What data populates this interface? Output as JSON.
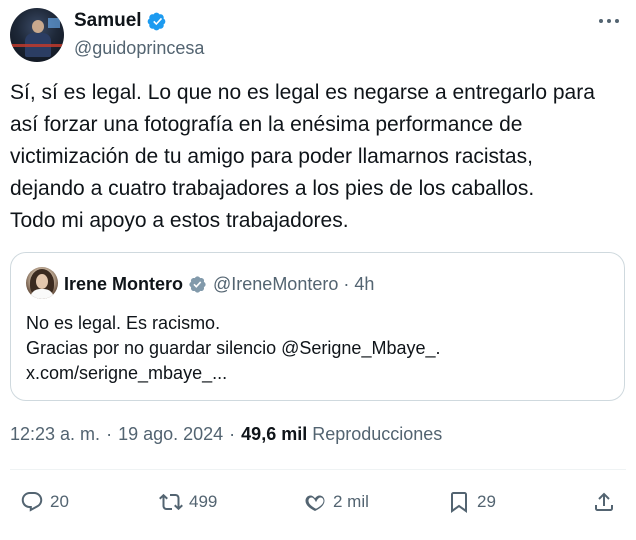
{
  "author": {
    "display_name": "Samuel",
    "handle": "@guidoprincesa"
  },
  "tweet": {
    "text_lines": [
      "Sí, sí es legal. Lo que no es legal es negarse a entregarlo para",
      "así forzar una fotografía en la enésima performance de",
      "victimización de tu amigo para poder llamarnos racistas,",
      "dejando a cuatro trabajadores a los pies de los caballos.",
      "Todo mi apoyo a estos trabajadores."
    ]
  },
  "quoted": {
    "display_name": "Irene Montero",
    "handle": "@IreneMontero",
    "separator": "·",
    "time": "4h",
    "body_lines": [
      "No es legal. Es racismo.",
      "Gracias por no guardar silencio @Serigne_Mbaye_.",
      "x.com/serigne_mbaye_..."
    ]
  },
  "meta": {
    "time": "12:23 a. m.",
    "separator": "·",
    "date": "19 ago. 2024",
    "separator2": "·",
    "views_count": "49,6 mil",
    "views_label": "Reproducciones"
  },
  "actions": {
    "reply_count": "20",
    "repost_count": "499",
    "like_count": "2 mil",
    "bookmark_count": "29"
  },
  "icons": {
    "verified": "verified-badge-icon",
    "more": "more-options-icon",
    "reply": "reply-icon",
    "repost": "repost-icon",
    "like": "like-icon",
    "bookmark": "bookmark-icon",
    "share": "share-icon"
  },
  "colors": {
    "verified_blue": "#1d9bf0",
    "verified_gray": "#829aab",
    "text": "#0f1419",
    "secondary": "#536471",
    "border": "#cfd9de"
  }
}
